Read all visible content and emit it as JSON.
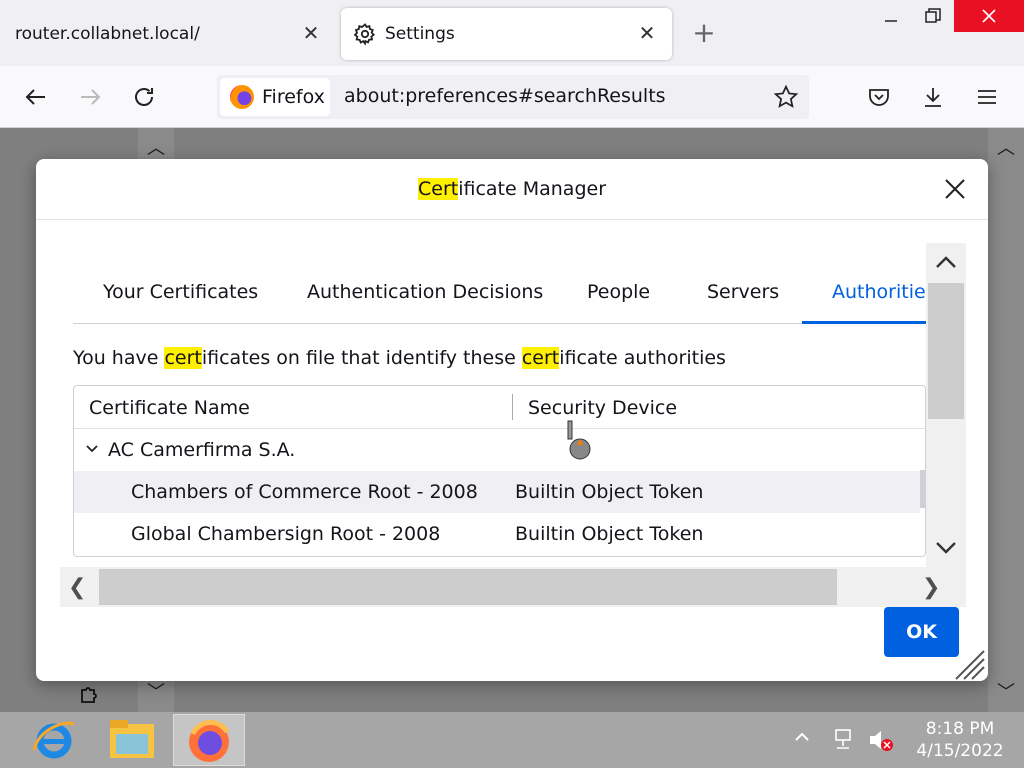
{
  "browser": {
    "tabs": [
      {
        "label": "router.collabnet.local/",
        "active": false
      },
      {
        "label": "Settings",
        "active": true
      }
    ],
    "identity_label": "Firefox",
    "url": "about:preferences#searchResults"
  },
  "dialog": {
    "title_highlight": "Cert",
    "title_rest": "ificate Manager",
    "tabs": [
      {
        "label": "Your Certificates"
      },
      {
        "label": "Authentication Decisions"
      },
      {
        "label": "People"
      },
      {
        "label": "Servers"
      },
      {
        "label": "Authorities",
        "selected": true
      }
    ],
    "description": {
      "p1": "You have ",
      "h1": "cert",
      "p2": "ificates on file that identify these ",
      "h2": "cert",
      "p3": "ificate authorities"
    },
    "columns": [
      "Certificate Name",
      "Security Device"
    ],
    "rows": [
      {
        "name": "AC Camerfirma S.A.",
        "device": ""
      },
      {
        "name": "Chambers of Commerce Root - 2008",
        "device": "Builtin Object Token"
      },
      {
        "name": "Global Chambersign Root - 2008",
        "device": "Builtin Object Token"
      }
    ],
    "ok_label": "OK"
  },
  "taskbar": {
    "time": "8:18 PM",
    "date": "4/15/2022"
  },
  "colors": {
    "accent": "#0061e0",
    "search_highlight": "#ffef00",
    "window_close": "#e81123"
  }
}
